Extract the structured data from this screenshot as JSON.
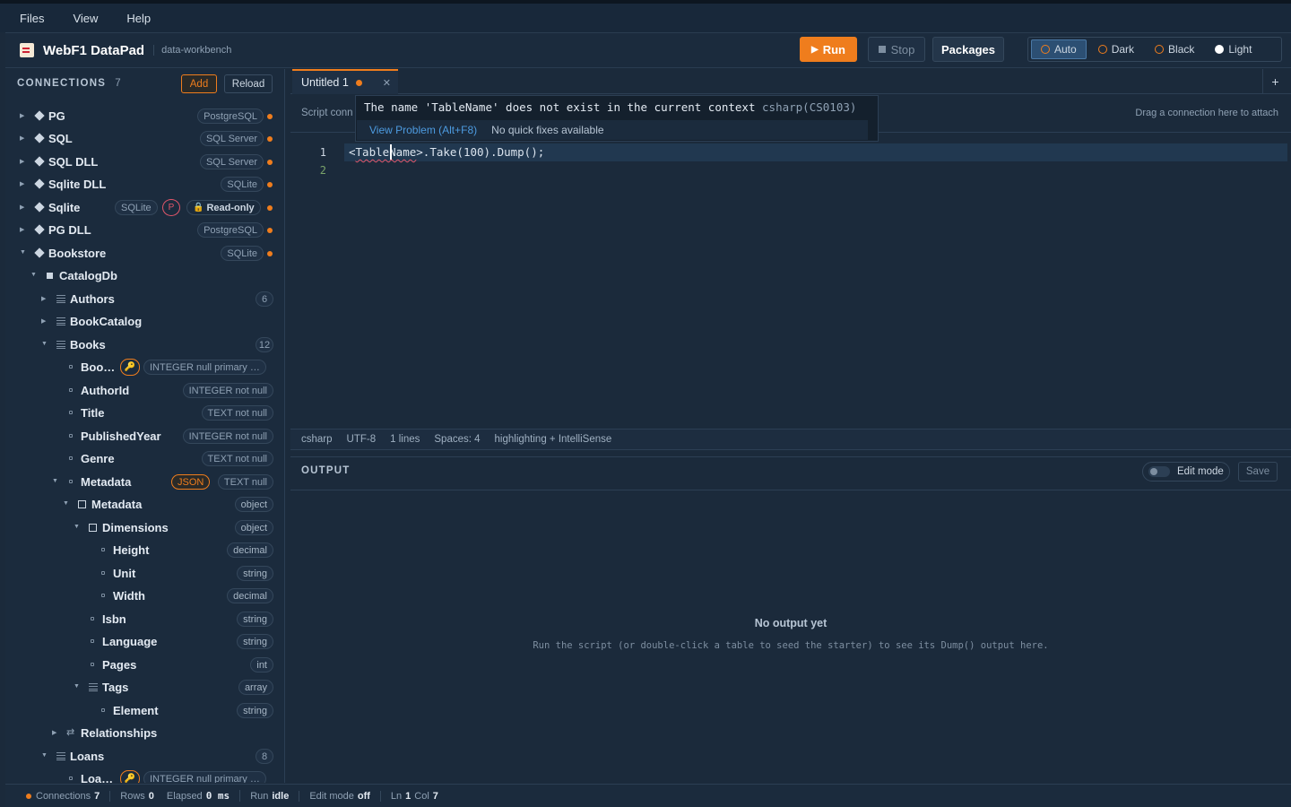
{
  "menu": [
    "Files",
    "View",
    "Help"
  ],
  "app": {
    "title": "WebF1 DataPad",
    "subtitle": "data-workbench"
  },
  "toolbar": {
    "run": "Run",
    "stop": "Stop",
    "packages": "Packages"
  },
  "themes": [
    "Auto",
    "Dark",
    "Black",
    "Light"
  ],
  "active_theme": "Auto",
  "sidebar": {
    "title": "CONNECTIONS",
    "count": "7",
    "add": "Add",
    "reload": "Reload",
    "connections": [
      {
        "name": "PG",
        "type": "PostgreSQL"
      },
      {
        "name": "SQL",
        "type": "SQL Server"
      },
      {
        "name": "SQL DLL",
        "type": "SQL Server"
      },
      {
        "name": "Sqlite DLL",
        "type": "SQLite"
      },
      {
        "name": "Sqlite",
        "type": "SQLite",
        "p": "P",
        "readonly": "Read-only"
      },
      {
        "name": "PG DLL",
        "type": "PostgreSQL"
      },
      {
        "name": "Bookstore",
        "type": "SQLite"
      }
    ],
    "tree": [
      {
        "name": "CatalogDb"
      },
      {
        "name": "Authors",
        "count": "6"
      },
      {
        "name": "BookCatalog"
      },
      {
        "name": "Books",
        "count": "12"
      },
      {
        "name": "Boo…",
        "type": "INTEGER null primary …"
      },
      {
        "name": "AuthorId",
        "type": "INTEGER not null"
      },
      {
        "name": "Title",
        "type": "TEXT not null"
      },
      {
        "name": "PublishedYear",
        "type": "INTEGER not null"
      },
      {
        "name": "Genre",
        "type": "TEXT not null"
      },
      {
        "name": "Metadata",
        "json": "JSON",
        "type": "TEXT null"
      },
      {
        "name": "Metadata",
        "type": "object"
      },
      {
        "name": "Dimensions",
        "type": "object"
      },
      {
        "name": "Height",
        "type": "decimal"
      },
      {
        "name": "Unit",
        "type": "string"
      },
      {
        "name": "Width",
        "type": "decimal"
      },
      {
        "name": "Isbn",
        "type": "string"
      },
      {
        "name": "Language",
        "type": "string"
      },
      {
        "name": "Pages",
        "type": "int"
      },
      {
        "name": "Tags",
        "type": "array"
      },
      {
        "name": "Element",
        "type": "string"
      },
      {
        "name": "Relationships"
      },
      {
        "name": "Loans",
        "count": "8"
      },
      {
        "name": "Loa…",
        "type": "INTEGER null primary …"
      }
    ]
  },
  "editor": {
    "tab": "Untitled 1",
    "script_label": "Script conn",
    "drag_hint": "Drag a connection here to attach",
    "lines": [
      "1",
      "2"
    ],
    "code": {
      "pre": "<",
      "err": "TableName",
      "post": ">.Take(100).Dump();"
    },
    "hover": {
      "message": "The name 'TableName' does not exist in the current context",
      "code": "csharp(CS0103)",
      "view_problem": "View Problem (Alt+F8)",
      "no_fix": "No quick fixes available"
    },
    "status": [
      "csharp",
      "UTF-8",
      "1 lines",
      "Spaces: 4",
      "highlighting + IntelliSense"
    ]
  },
  "output": {
    "title": "OUTPUT",
    "edit_mode": "Edit mode",
    "save": "Save",
    "empty_title": "No output yet",
    "empty_sub": "Run the script (or double-click a table to seed the starter) to see its Dump() output here."
  },
  "footer": {
    "connections_label": "Connections",
    "connections": "7",
    "rows_label": "Rows",
    "rows": "0",
    "elapsed_label": "Elapsed",
    "elapsed": "0 ms",
    "run_label": "Run",
    "run": "idle",
    "edit_label": "Edit mode",
    "edit": "off",
    "ln_label": "Ln",
    "ln": "1",
    "col_label": "Col",
    "col": "7"
  },
  "colors": {
    "accent": "#ef7d1d",
    "error": "#e0566a",
    "link": "#4d9be0",
    "background": "#1b2a3b"
  }
}
